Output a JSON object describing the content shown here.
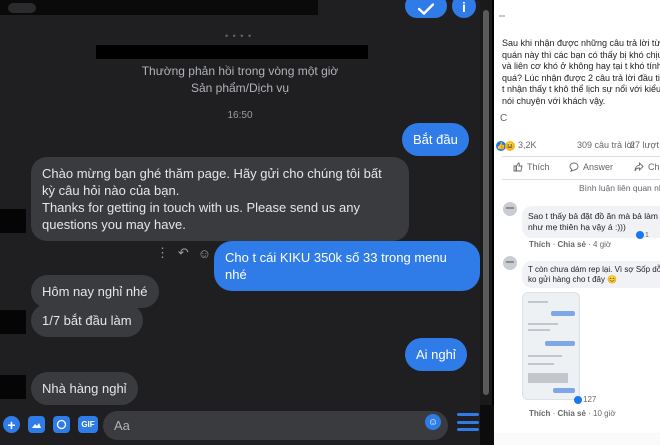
{
  "messenger": {
    "info_line_1": "Thường phản hồi trong vòng một giờ",
    "info_line_2": "Sản phẩm/Dịch vụ",
    "header_dots": "• • • •",
    "timestamp": "16:50",
    "info_button": "i",
    "messages": {
      "start": "Bắt đầu",
      "welcome_vi": "Chào mừng bạn ghé thăm page. Hãy gửi cho chúng tôi bất kỳ câu hỏi nào của bạn.",
      "welcome_en": "Thanks for getting in touch with us. Please send us any questions you may have.",
      "order": "Cho t cái KIKU 350k số 33 trong menu nhé",
      "closed_today": "Hôm nay nghỉ nhé",
      "starts": "1/7 bắt đầu làm",
      "who_closed": "Ai nghỉ",
      "restaurant_closed": "Nhà hàng nghỉ"
    },
    "composer": {
      "placeholder": "Aa",
      "gif_label": "GIF",
      "plus_label": "+"
    },
    "icons": {
      "check": "check-icon",
      "info": "info-icon",
      "more": "more-vertical-icon",
      "reply": "reply-icon",
      "react": "smiley-icon",
      "plus": "plus-circle-icon",
      "photo": "photo-icon",
      "sticker": "sticker-icon",
      "gif": "gif-icon",
      "emoji": "emoji-icon",
      "menu": "menu-icon"
    },
    "colors": {
      "accent": "#2f7ce8",
      "background": "#1f1f21",
      "incoming_bubble": "#3a3b3e"
    }
  },
  "facebook_post": {
    "text": "Sau khi nhận được những câu trả lời từ quán này thì các bạn có thấy bị khó chịu và liên cơ khó ở không hay tại t khó tính quá? Lúc nhận được 2 câu trả lời đầu tiên t nhận thấy t khô thể lịch sự nổi với kiểu nói chuyện với khách vậy.",
    "fragment_c": "C",
    "reactions_count": "3,2K",
    "comments_count": "309 câu trả lời",
    "shares_count": "27 lượt",
    "actions": {
      "like": "Thích",
      "answer": "Answer",
      "share": "Chi"
    },
    "sort_label": "Bình luận liên quan nh",
    "comments": [
      {
        "text": "Sao t thấy bả đặt đồ ăn mà bả làm như mẹ thiên hạ vậy á :)))",
        "reactions": "1",
        "like": "Thích",
        "share": "Chia sẻ",
        "time": "4 giờ"
      },
      {
        "text": "T còn chưa dám rep lại. Vì sợ Sốp dỗi ko gửi hàng cho t đây 😊",
        "reactions": "127",
        "like": "Thích",
        "share": "Chia sẻ",
        "time": "10 giờ"
      }
    ]
  }
}
